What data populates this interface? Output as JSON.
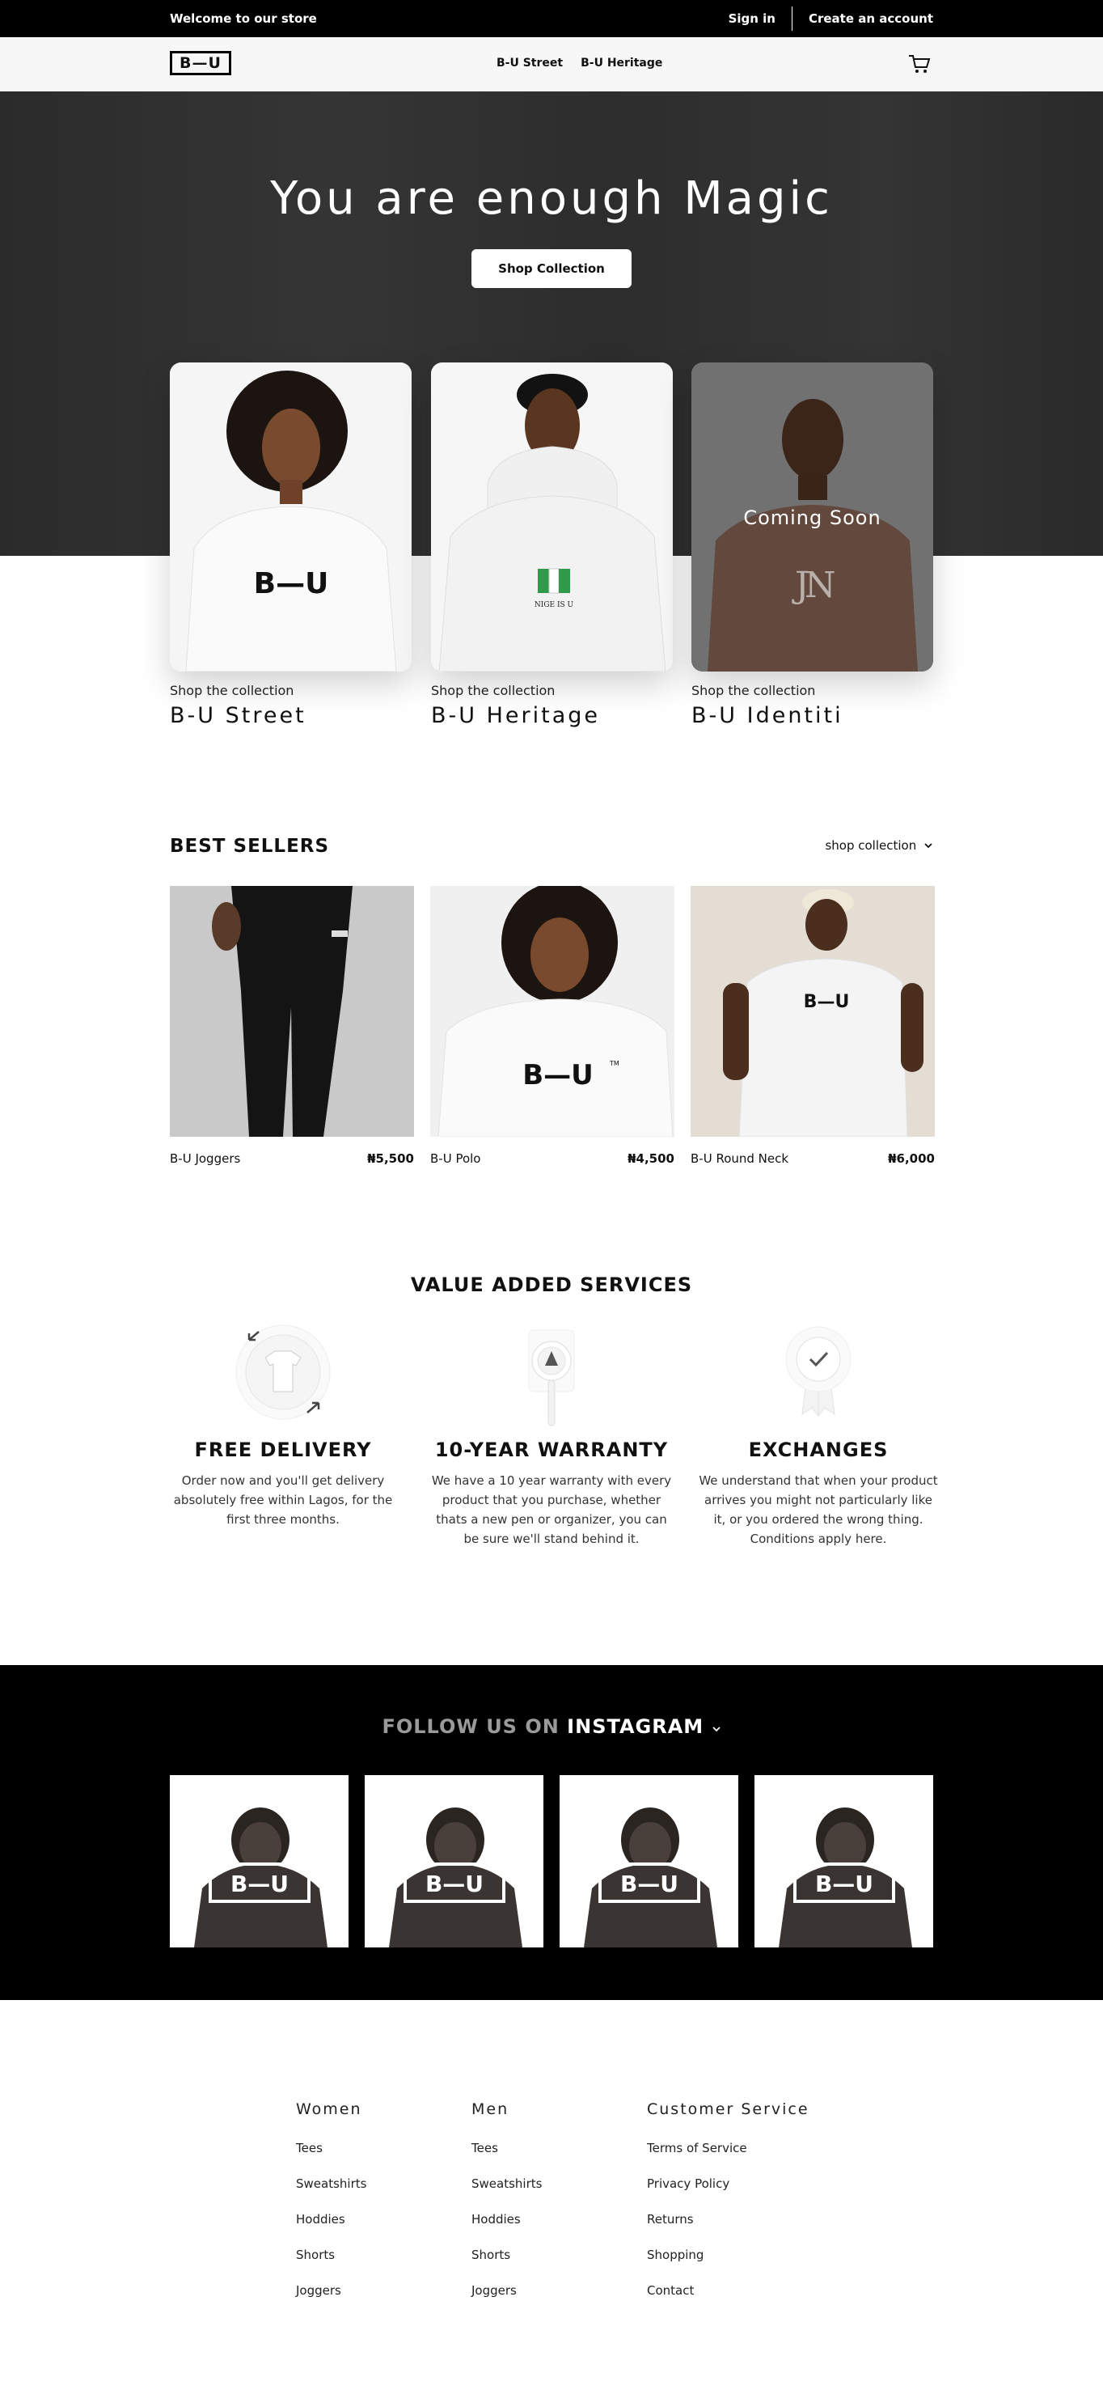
{
  "topbar": {
    "welcome": "Welcome to our store",
    "signin": "Sign in",
    "create": "Create an account"
  },
  "nav": {
    "logo": "B—U",
    "menu": [
      "B-U Street",
      "B-U Heritage"
    ]
  },
  "hero": {
    "title": "You are enough Magic",
    "button": "Shop Collection"
  },
  "collections": [
    {
      "sub": "Shop the collection",
      "name": "B-U Street",
      "badge": ""
    },
    {
      "sub": "Shop the collection",
      "name": "B-U Heritage",
      "badge": ""
    },
    {
      "sub": "Shop the collection",
      "name": "B-U Identiti",
      "badge": "Coming Soon"
    }
  ],
  "best_sellers": {
    "title": "BEST SELLERS",
    "link": "shop collection",
    "products": [
      {
        "name": "B-U Joggers",
        "price": "₦5,500"
      },
      {
        "name": "B-U Polo",
        "price": "₦4,500"
      },
      {
        "name": "B-U Round Neck",
        "price": "₦6,000"
      }
    ]
  },
  "services": {
    "title": "VALUE ADDED SERVICES",
    "items": [
      {
        "title": "FREE DELIVERY",
        "text": "Order now and you'll get delivery absolutely free within Lagos, for the first three months."
      },
      {
        "title": "10-YEAR WARRANTY",
        "text": "We have a 10 year warranty with every product that you purchase, whether thats a new pen or organizer, you can be sure we'll stand behind it."
      },
      {
        "title": "EXCHANGES",
        "text": "We understand that when your product arrives you might not particularly like it, or you ordered the wrong thing. Conditions apply here."
      }
    ]
  },
  "instagram": {
    "prefix": "FOLLOW US ON ",
    "brand": "INSTAGRAM",
    "tile_logo": "B—U"
  },
  "print": {
    "shirt_logo": "B—U",
    "heritage_text": "NIGE IS U",
    "tm": "TM"
  },
  "footer": {
    "columns": [
      {
        "title": "Women",
        "items": [
          "Tees",
          "Sweatshirts",
          "Hoddies",
          "Shorts",
          "Joggers"
        ]
      },
      {
        "title": "Men",
        "items": [
          "Tees",
          "Sweatshirts",
          "Hoddies",
          "Shorts",
          "Joggers"
        ]
      },
      {
        "title": "Customer Service",
        "items": [
          "Terms of Service",
          "Privacy Policy",
          "Returns",
          "Shopping",
          "Contact"
        ]
      }
    ]
  }
}
